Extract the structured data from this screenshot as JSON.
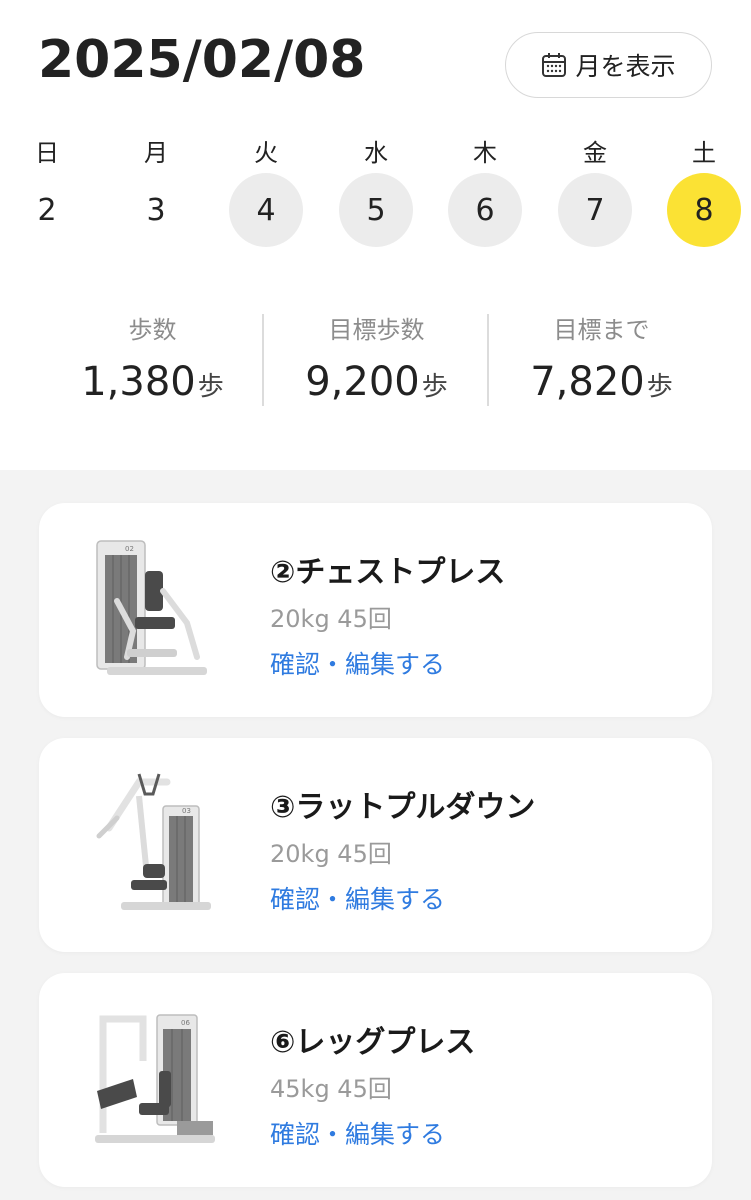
{
  "header": {
    "date": "2025/02/08",
    "month_button_label": "月を表示",
    "month_button_icon": "calendar-icon"
  },
  "week": {
    "days": [
      {
        "name": "日",
        "num": "2",
        "state": "none"
      },
      {
        "name": "月",
        "num": "3",
        "state": "none"
      },
      {
        "name": "火",
        "num": "4",
        "state": "past"
      },
      {
        "name": "水",
        "num": "5",
        "state": "past"
      },
      {
        "name": "木",
        "num": "6",
        "state": "past"
      },
      {
        "name": "金",
        "num": "7",
        "state": "past"
      },
      {
        "name": "土",
        "num": "8",
        "state": "today"
      }
    ],
    "today_color": "#fbe234",
    "past_color": "#ececec"
  },
  "stats": [
    {
      "label": "歩数",
      "value": "1,380",
      "unit": "歩"
    },
    {
      "label": "目標歩数",
      "value": "9,200",
      "unit": "歩"
    },
    {
      "label": "目標まで",
      "value": "7,820",
      "unit": "歩"
    }
  ],
  "workouts": [
    {
      "title": "②チェストプレス",
      "detail": "20kg 45回",
      "link": "確認・編集する",
      "icon": "chest-press-machine-icon"
    },
    {
      "title": "③ラットプルダウン",
      "detail": "20kg 45回",
      "link": "確認・編集する",
      "icon": "lat-pulldown-machine-icon"
    },
    {
      "title": "⑥レッグプレス",
      "detail": "45kg 45回",
      "link": "確認・編集する",
      "icon": "leg-press-machine-icon"
    }
  ],
  "colors": {
    "accent_link": "#2f7be0",
    "background": "#f3f3f3"
  }
}
